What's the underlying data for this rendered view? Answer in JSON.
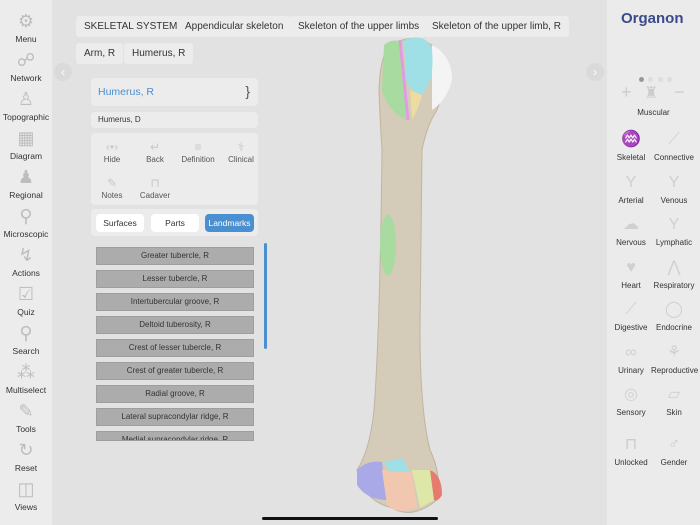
{
  "left_nav": [
    {
      "label": "Menu",
      "icon": "gear-icon",
      "glyph": "⚙"
    },
    {
      "label": "Network",
      "icon": "network-icon",
      "glyph": "☍"
    },
    {
      "label": "Topographic",
      "icon": "body-icon",
      "glyph": "♙"
    },
    {
      "label": "Diagram",
      "icon": "diagram-icon",
      "glyph": "▦"
    },
    {
      "label": "Regional",
      "icon": "regional-icon",
      "glyph": "♟"
    },
    {
      "label": "Microscopic",
      "icon": "microscope-icon",
      "glyph": "⚲"
    },
    {
      "label": "Actions",
      "icon": "actions-icon",
      "glyph": "↯"
    },
    {
      "label": "Quiz",
      "icon": "quiz-icon",
      "glyph": "☑"
    },
    {
      "label": "Search",
      "icon": "search-icon",
      "glyph": "⚲"
    },
    {
      "label": "Multiselect",
      "icon": "multiselect-icon",
      "glyph": "⁂"
    },
    {
      "label": "Tools",
      "icon": "tools-icon",
      "glyph": "✎"
    },
    {
      "label": "Reset",
      "icon": "reset-icon",
      "glyph": "↻"
    },
    {
      "label": "Views",
      "icon": "cube-icon",
      "glyph": "◫"
    }
  ],
  "breadcrumbs": [
    "SKELETAL SYSTEM",
    "Appendicular skeleton",
    "Skeleton of the upper limbs",
    "Skeleton of the upper limb, R",
    "Arm, R",
    "Humerus, R"
  ],
  "structure": {
    "title": "Humerus, R",
    "latin": "Humerus, D"
  },
  "tools": [
    {
      "label": "Hide",
      "icon": "eye-icon",
      "glyph": "‹•›"
    },
    {
      "label": "Back",
      "icon": "back-icon",
      "glyph": "↵"
    },
    {
      "label": "Definition",
      "icon": "definition-icon",
      "glyph": "≡"
    },
    {
      "label": "Clinical",
      "icon": "clinical-icon",
      "glyph": "⚕"
    },
    {
      "label": "Notes",
      "icon": "notes-icon",
      "glyph": "✎"
    },
    {
      "label": "Cadaver",
      "icon": "cadaver-icon",
      "glyph": "⊓"
    }
  ],
  "segments": {
    "surfaces": "Surfaces",
    "parts": "Parts",
    "landmarks": "Landmarks",
    "active": "Landmarks"
  },
  "landmarks": [
    "Greater tubercle, R",
    "Lesser tubercle, R",
    "Intertubercular groove, R",
    "Deltoid tuberosity, R",
    "Crest of lesser tubercle, R",
    "Crest of greater tubercle, R",
    "Radial groove, R",
    "Lateral supracondylar ridge, R",
    "Medial supracondylar ridge, R"
  ],
  "brand": "Organon",
  "right": {
    "current_system": "Muscular",
    "plus": "+",
    "minus": "−",
    "systems": [
      {
        "label": "Skeletal",
        "glyph": "♒"
      },
      {
        "label": "Connective",
        "glyph": "⟋"
      },
      {
        "label": "Arterial",
        "glyph": "Y"
      },
      {
        "label": "Venous",
        "glyph": "Y"
      },
      {
        "label": "Nervous",
        "glyph": "☁"
      },
      {
        "label": "Lymphatic",
        "glyph": "Y"
      },
      {
        "label": "Heart",
        "glyph": "♥"
      },
      {
        "label": "Respiratory",
        "glyph": "⋀"
      },
      {
        "label": "Digestive",
        "glyph": "⟋"
      },
      {
        "label": "Endocrine",
        "glyph": "◯"
      },
      {
        "label": "Urinary",
        "glyph": "∞"
      },
      {
        "label": "Reproductive",
        "glyph": "⚘"
      },
      {
        "label": "Sensory",
        "glyph": "◎"
      },
      {
        "label": "Skin",
        "glyph": "▱"
      }
    ],
    "unlocked": "Unlocked",
    "gender": "Gender"
  },
  "colors": {
    "accent": "#4a90d0",
    "title": "#4a8fd0"
  }
}
